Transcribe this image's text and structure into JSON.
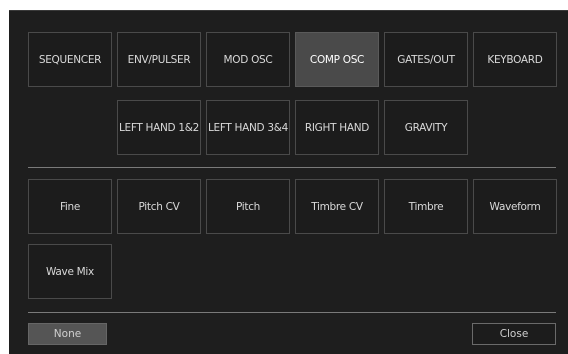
{
  "tabs_row1": [
    "SEQUENCER",
    "ENV/PULSER",
    "MOD OSC",
    "COMP OSC",
    "GATES/OUT",
    "KEYBOARD"
  ],
  "tabs_row2": [
    "LEFT HAND 1&2",
    "LEFT HAND 3&4",
    "RIGHT HAND",
    "GRAVITY"
  ],
  "active_tab": "COMP OSC",
  "params_row1": [
    "Fine",
    "Pitch CV",
    "Pitch",
    "Timbre CV",
    "Timbre",
    "Waveform"
  ],
  "params_row2": [
    "Wave Mix"
  ],
  "footer": {
    "none_label": "None",
    "close_label": "Close"
  },
  "colors": {
    "panel_bg": "#1e1e1e",
    "active_bg": "#4a4a4a",
    "border": "#4a4a4a",
    "text": "#d9d9d9"
  }
}
